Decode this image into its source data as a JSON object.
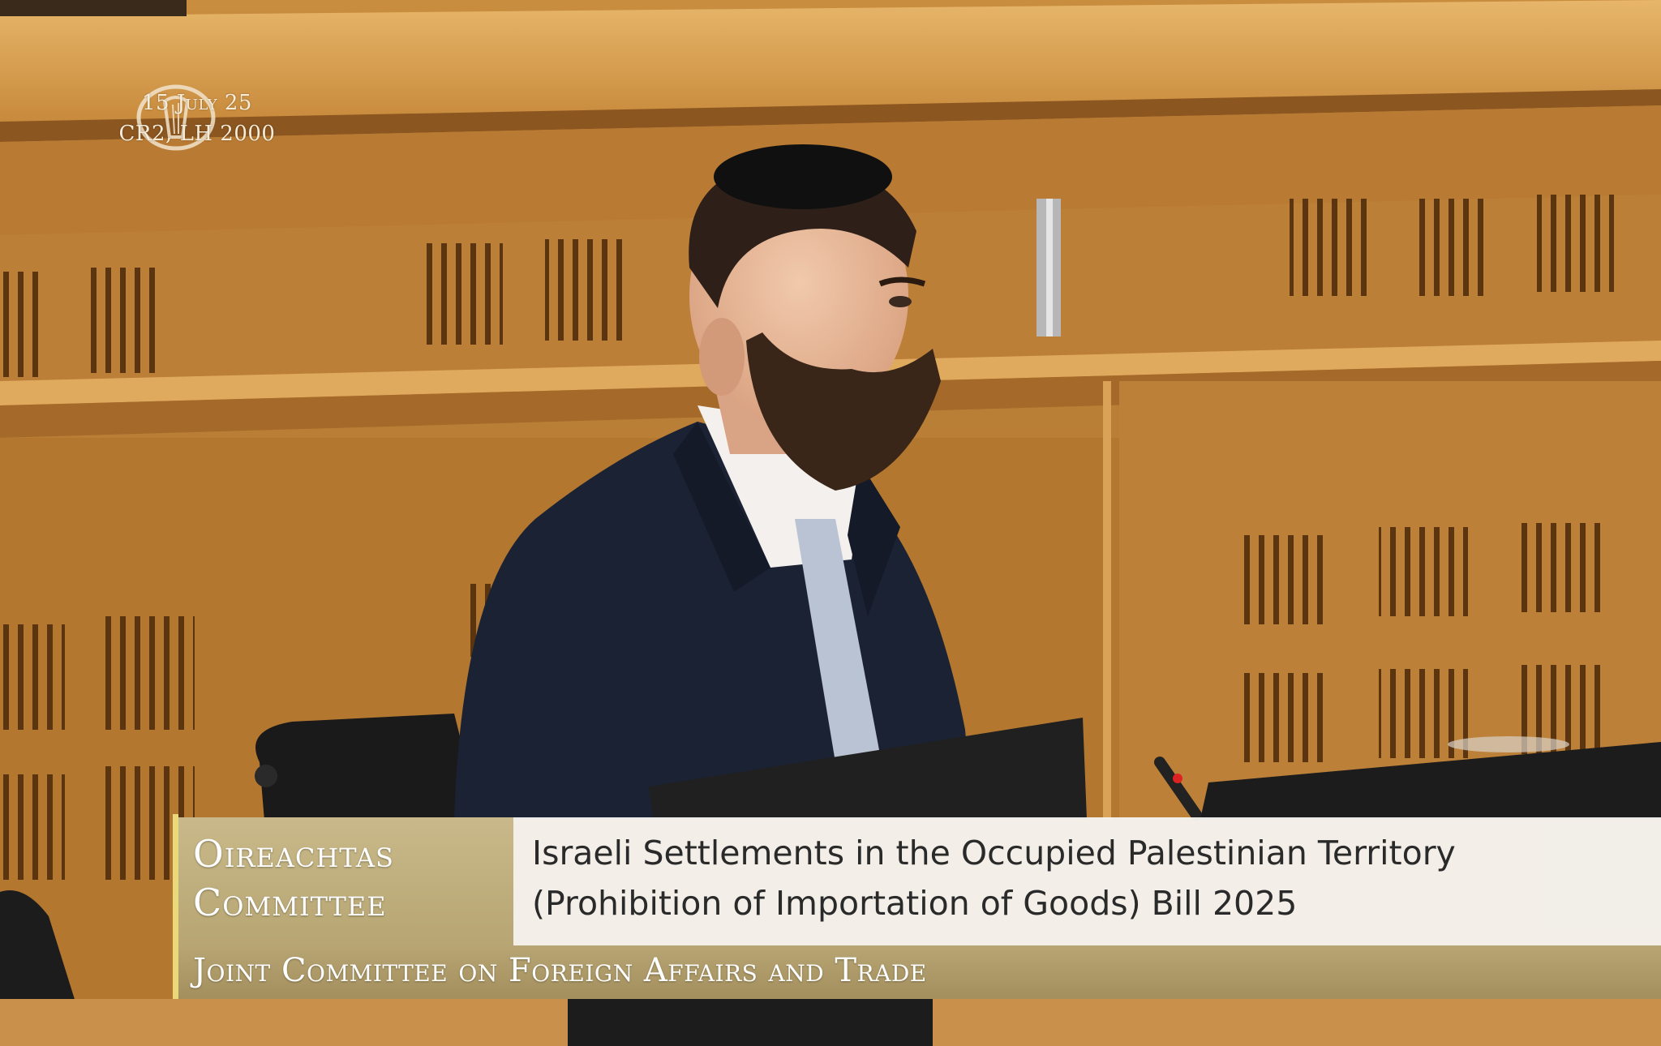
{
  "watermark": {
    "logo_icon": "harp-icon",
    "date": "15 July 25",
    "room": "CR2, LH 2000"
  },
  "lower_third": {
    "brand_line1": "Oireachtas",
    "brand_line2": "Committee",
    "title_line1": "Israeli Settlements in the Occupied Palestinian Territory",
    "title_line2": "(Prohibition of Importation of Goods) Bill 2025",
    "committee": "Joint Committee on Foreign Affairs and Trade"
  }
}
